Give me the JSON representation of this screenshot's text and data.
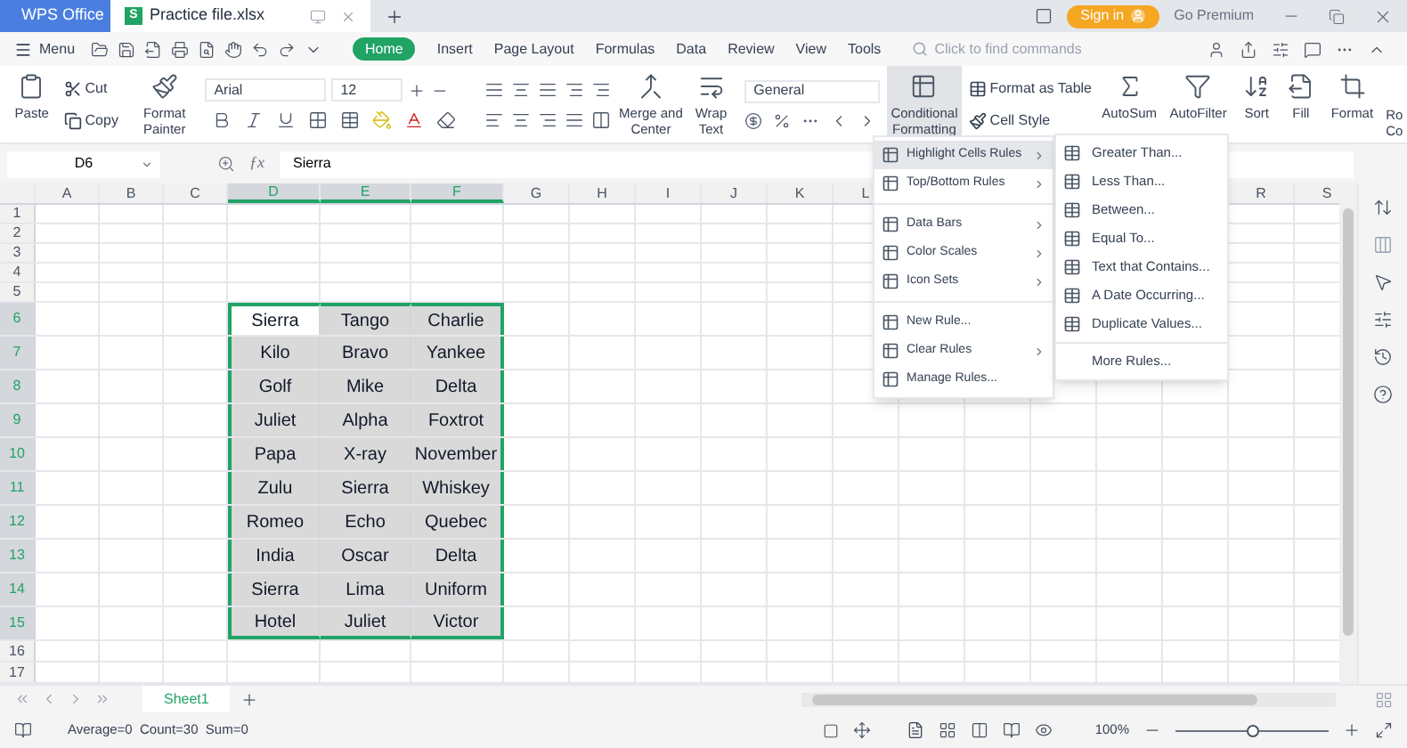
{
  "title_bar": {
    "tabs": [
      {
        "label": "WPS Office",
        "kind": "home",
        "selected": false
      },
      {
        "label": "Practice file.xlsx",
        "kind": "doc",
        "selected": true
      }
    ],
    "doc_letter": "S",
    "sign_in": "Sign in",
    "premium": "Go Premium"
  },
  "menu_bar": {
    "menu": "Menu",
    "tabs": [
      {
        "label": "Home",
        "selected": true
      },
      {
        "label": "Insert",
        "selected": false
      },
      {
        "label": "Page Layout",
        "selected": false
      },
      {
        "label": "Formulas",
        "selected": false
      },
      {
        "label": "Data",
        "selected": false
      },
      {
        "label": "Review",
        "selected": false
      },
      {
        "label": "View",
        "selected": false
      },
      {
        "label": "Tools",
        "selected": false
      }
    ],
    "search": {
      "placeholder": "Click to find commands"
    }
  },
  "ribbon": {
    "paste": "Paste",
    "cut": "Cut",
    "copy": "Copy",
    "format_painter": "Format Painter",
    "font": "Arial",
    "font_size": "12",
    "merge": "Merge and Center",
    "wrap": "Wrap Text",
    "number_format": "General",
    "conditional": {
      "label": "Conditional Formatting",
      "expanded": true
    },
    "format_as_table": "Format as Table",
    "cell_style": "Cell Style",
    "autosum": "AutoSum",
    "autofilter": "AutoFilter",
    "sort": "Sort",
    "fill": "Fill",
    "format": "Format",
    "column_cut": "Ro Co"
  },
  "formula_bar": {
    "cell_ref": "D6",
    "function_label": "ƒx",
    "value": "Sierra"
  },
  "sheet": {
    "columns": [
      {
        "label": "A",
        "selected": false
      },
      {
        "label": "B",
        "selected": false
      },
      {
        "label": "C",
        "selected": false
      },
      {
        "label": "D",
        "selected": true
      },
      {
        "label": "E",
        "selected": true
      },
      {
        "label": "F",
        "selected": true
      },
      {
        "label": "G",
        "selected": false
      },
      {
        "label": "H",
        "selected": false
      },
      {
        "label": "I",
        "selected": false
      },
      {
        "label": "J",
        "selected": false
      },
      {
        "label": "K",
        "selected": false
      },
      {
        "label": "L",
        "selected": false
      }
    ],
    "columns_right": [
      {
        "label": "R",
        "selected": false
      },
      {
        "label": "S",
        "selected": false
      }
    ],
    "rows": [
      {
        "number": "1",
        "selected": false
      },
      {
        "number": "2",
        "selected": false
      },
      {
        "number": "3",
        "selected": false
      },
      {
        "number": "4",
        "selected": false
      },
      {
        "number": "5",
        "selected": false
      },
      {
        "number": "6",
        "selected": true,
        "cells": [
          {
            "text": "Sierra",
            "active": true
          },
          {
            "text": "Tango",
            "active": false
          },
          {
            "text": "Charlie",
            "active": false
          }
        ]
      },
      {
        "number": "7",
        "selected": true,
        "cells": [
          {
            "text": "Kilo",
            "active": false
          },
          {
            "text": "Bravo",
            "active": false
          },
          {
            "text": "Yankee",
            "active": false
          }
        ]
      },
      {
        "number": "8",
        "selected": true,
        "cells": [
          {
            "text": "Golf",
            "active": false
          },
          {
            "text": "Mike",
            "active": false
          },
          {
            "text": "Delta",
            "active": false
          }
        ]
      },
      {
        "number": "9",
        "selected": true,
        "cells": [
          {
            "text": "Juliet",
            "active": false
          },
          {
            "text": "Alpha",
            "active": false
          },
          {
            "text": "Foxtrot",
            "active": false
          }
        ]
      },
      {
        "number": "10",
        "selected": true,
        "cells": [
          {
            "text": "Papa",
            "active": false
          },
          {
            "text": "X-ray",
            "active": false
          },
          {
            "text": "November",
            "active": false
          }
        ]
      },
      {
        "number": "11",
        "selected": true,
        "cells": [
          {
            "text": "Zulu",
            "active": false
          },
          {
            "text": "Sierra",
            "active": false
          },
          {
            "text": "Whiskey",
            "active": false
          }
        ]
      },
      {
        "number": "12",
        "selected": true,
        "cells": [
          {
            "text": "Romeo",
            "active": false
          },
          {
            "text": "Echo",
            "active": false
          },
          {
            "text": "Quebec",
            "active": false
          }
        ]
      },
      {
        "number": "13",
        "selected": true,
        "cells": [
          {
            "text": "India",
            "active": false
          },
          {
            "text": "Oscar",
            "active": false
          },
          {
            "text": "Delta",
            "active": false
          }
        ]
      },
      {
        "number": "14",
        "selected": true,
        "cells": [
          {
            "text": "Sierra",
            "active": false
          },
          {
            "text": "Lima",
            "active": false
          },
          {
            "text": "Uniform",
            "active": false
          }
        ]
      },
      {
        "number": "15",
        "selected": true,
        "cells": [
          {
            "text": "Hotel",
            "active": false
          },
          {
            "text": "Juliet",
            "active": false
          },
          {
            "text": "Victor",
            "active": false
          }
        ]
      },
      {
        "number": "16",
        "selected": false
      },
      {
        "number": "17",
        "selected": false
      }
    ]
  },
  "conditional_menu": {
    "sections": [
      {
        "items": [
          {
            "label": "Highlight Cells Rules",
            "submenu": true,
            "selected": true
          },
          {
            "label": "Top/Bottom Rules",
            "submenu": true,
            "selected": false
          }
        ]
      },
      {
        "items": [
          {
            "label": "Data Bars",
            "submenu": true,
            "selected": false
          },
          {
            "label": "Color Scales",
            "submenu": true,
            "selected": false
          },
          {
            "label": "Icon Sets",
            "submenu": true,
            "selected": false
          }
        ]
      },
      {
        "items": [
          {
            "label": "New Rule...",
            "submenu": false,
            "selected": false
          },
          {
            "label": "Clear Rules",
            "submenu": true,
            "selected": false
          },
          {
            "label": "Manage Rules...",
            "submenu": false,
            "selected": false
          }
        ]
      }
    ]
  },
  "highlight_submenu": {
    "items": [
      "Greater Than...",
      "Less Than...",
      "Between...",
      "Equal To...",
      "Text that Contains...",
      "A Date Occurring...",
      "Duplicate Values..."
    ],
    "more": "More Rules..."
  },
  "sheet_tabs": [
    {
      "label": "Sheet1",
      "selected": true
    }
  ],
  "status_bar": {
    "stats": "Average=0  Count=30  Sum=0",
    "zoom": "100%",
    "zoom_slider": {
      "level": 0.5
    }
  }
}
